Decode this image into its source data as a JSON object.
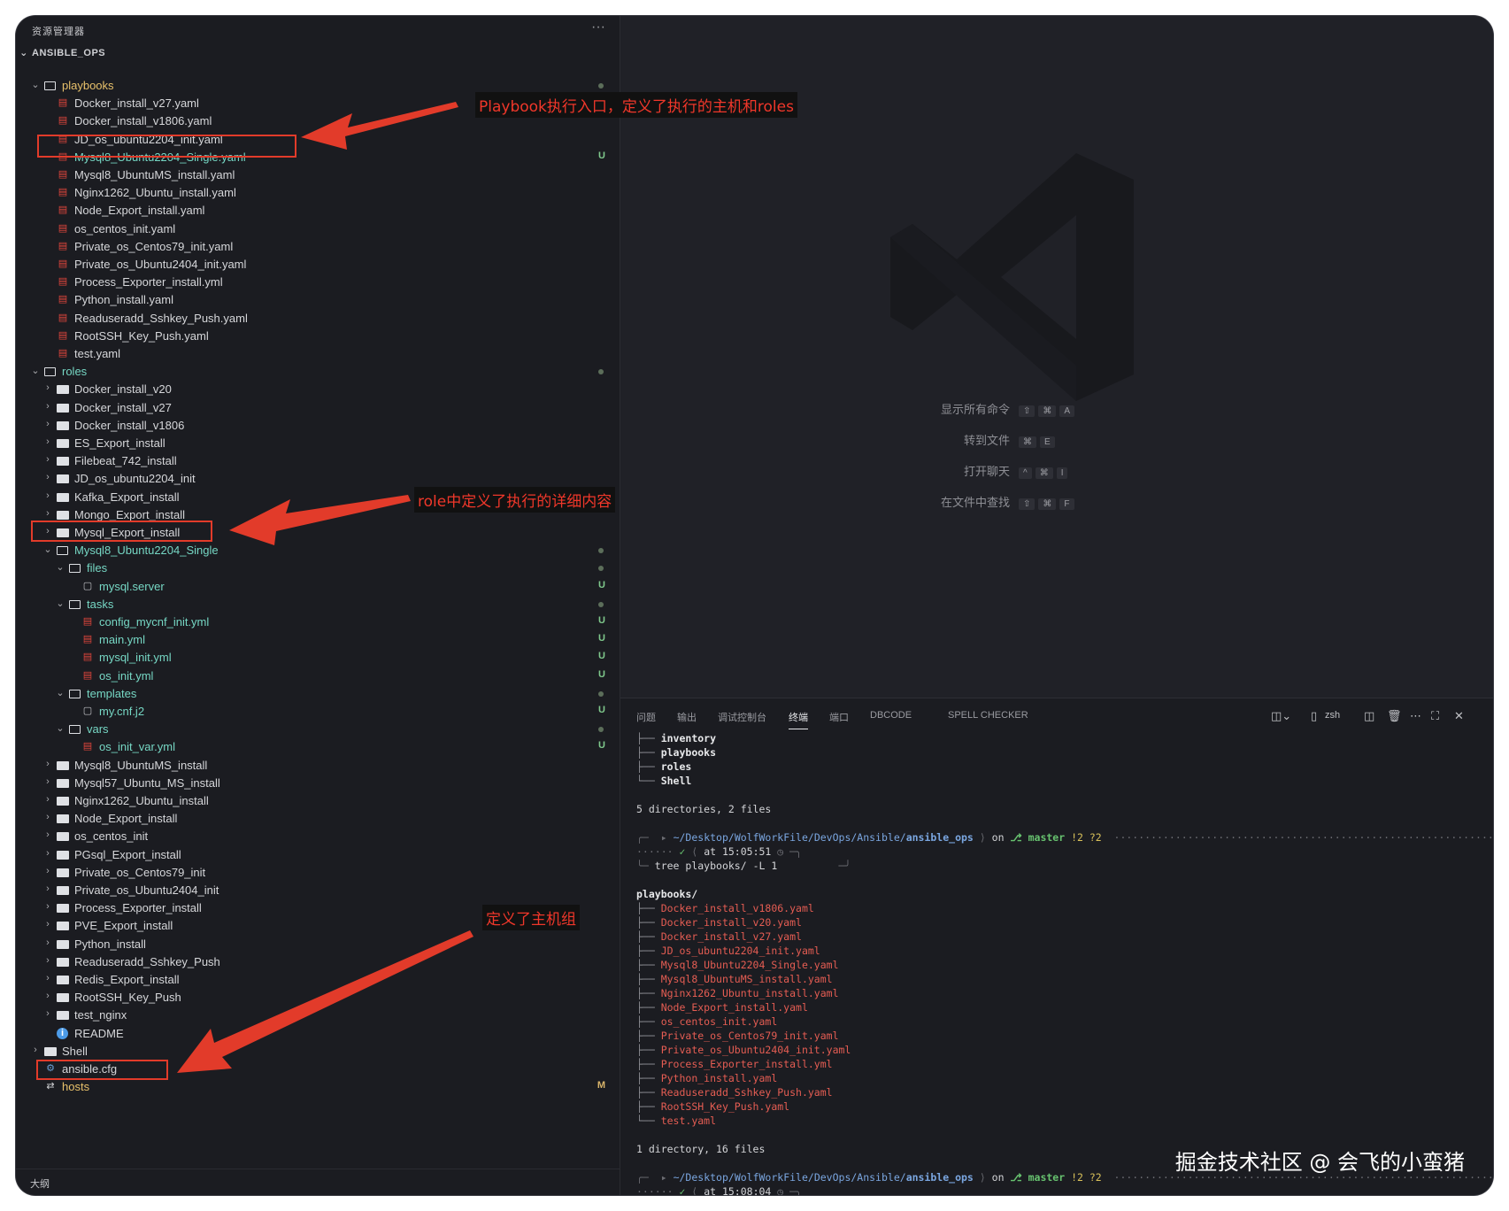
{
  "sidebar": {
    "title": "资源管理器",
    "more": "···",
    "section": "ANSIBLE_OPS",
    "outline": "大纲",
    "rows": [
      {
        "depth": 0,
        "twisty": "v",
        "icon": "folder-open",
        "label": "playbooks",
        "color": "yellow",
        "status": "dot"
      },
      {
        "depth": 1,
        "icon": "yaml",
        "label": "Docker_install_v27.yaml"
      },
      {
        "depth": 1,
        "icon": "yaml",
        "label": "Docker_install_v1806.yaml"
      },
      {
        "depth": 1,
        "icon": "yaml",
        "label": "JD_os_ubuntu2204_init.yaml"
      },
      {
        "depth": 1,
        "icon": "yaml",
        "label": "Mysql8_Ubuntu2204_Single.yaml",
        "color": "teal",
        "status": "U"
      },
      {
        "depth": 1,
        "icon": "yaml",
        "label": "Mysql8_UbuntuMS_install.yaml"
      },
      {
        "depth": 1,
        "icon": "yaml",
        "label": "Nginx1262_Ubuntu_install.yaml"
      },
      {
        "depth": 1,
        "icon": "yaml",
        "label": "Node_Export_install.yaml"
      },
      {
        "depth": 1,
        "icon": "yaml",
        "label": "os_centos_init.yaml"
      },
      {
        "depth": 1,
        "icon": "yaml",
        "label": "Private_os_Centos79_init.yaml"
      },
      {
        "depth": 1,
        "icon": "yaml",
        "label": "Private_os_Ubuntu2404_init.yaml"
      },
      {
        "depth": 1,
        "icon": "yaml",
        "label": "Process_Exporter_install.yml"
      },
      {
        "depth": 1,
        "icon": "yaml",
        "label": "Python_install.yaml"
      },
      {
        "depth": 1,
        "icon": "yaml",
        "label": "Readuseradd_Sshkey_Push.yaml"
      },
      {
        "depth": 1,
        "icon": "yaml",
        "label": "RootSSH_Key_Push.yaml"
      },
      {
        "depth": 1,
        "icon": "yaml",
        "label": "test.yaml"
      },
      {
        "depth": 0,
        "twisty": "v",
        "icon": "folder-open",
        "label": "roles",
        "color": "teal",
        "status": "dot"
      },
      {
        "depth": 1,
        "twisty": ">",
        "icon": "folder",
        "label": "Docker_install_v20"
      },
      {
        "depth": 1,
        "twisty": ">",
        "icon": "folder",
        "label": "Docker_install_v27"
      },
      {
        "depth": 1,
        "twisty": ">",
        "icon": "folder",
        "label": "Docker_install_v1806"
      },
      {
        "depth": 1,
        "twisty": ">",
        "icon": "folder",
        "label": "ES_Export_install"
      },
      {
        "depth": 1,
        "twisty": ">",
        "icon": "folder",
        "label": "Filebeat_742_install"
      },
      {
        "depth": 1,
        "twisty": ">",
        "icon": "folder",
        "label": "JD_os_ubuntu2204_init"
      },
      {
        "depth": 1,
        "twisty": ">",
        "icon": "folder",
        "label": "Kafka_Export_install"
      },
      {
        "depth": 1,
        "twisty": ">",
        "icon": "folder",
        "label": "Mongo_Export_install"
      },
      {
        "depth": 1,
        "twisty": ">",
        "icon": "folder",
        "label": "Mysql_Export_install"
      },
      {
        "depth": 1,
        "twisty": "v",
        "icon": "folder-open",
        "label": "Mysql8_Ubuntu2204_Single",
        "color": "teal",
        "status": "dot"
      },
      {
        "depth": 2,
        "twisty": "v",
        "icon": "folder-open",
        "label": "files",
        "color": "teal",
        "status": "dot"
      },
      {
        "depth": 3,
        "icon": "file",
        "label": "mysql.server",
        "color": "teal",
        "status": "U"
      },
      {
        "depth": 2,
        "twisty": "v",
        "icon": "folder-open",
        "label": "tasks",
        "color": "teal",
        "status": "dot"
      },
      {
        "depth": 3,
        "icon": "yaml",
        "label": "config_mycnf_init.yml",
        "color": "teal",
        "status": "U"
      },
      {
        "depth": 3,
        "icon": "yaml",
        "label": "main.yml",
        "color": "teal",
        "status": "U"
      },
      {
        "depth": 3,
        "icon": "yaml",
        "label": "mysql_init.yml",
        "color": "teal",
        "status": "U"
      },
      {
        "depth": 3,
        "icon": "yaml",
        "label": "os_init.yml",
        "color": "teal",
        "status": "U"
      },
      {
        "depth": 2,
        "twisty": "v",
        "icon": "folder-open",
        "label": "templates",
        "color": "teal",
        "status": "dot"
      },
      {
        "depth": 3,
        "icon": "file",
        "label": "my.cnf.j2",
        "color": "teal",
        "status": "U"
      },
      {
        "depth": 2,
        "twisty": "v",
        "icon": "folder-open",
        "label": "vars",
        "color": "teal",
        "status": "dot"
      },
      {
        "depth": 3,
        "icon": "yaml",
        "label": "os_init_var.yml",
        "color": "teal",
        "status": "U"
      },
      {
        "depth": 1,
        "twisty": ">",
        "icon": "folder",
        "label": "Mysql8_UbuntuMS_install"
      },
      {
        "depth": 1,
        "twisty": ">",
        "icon": "folder",
        "label": "Mysql57_Ubuntu_MS_install"
      },
      {
        "depth": 1,
        "twisty": ">",
        "icon": "folder",
        "label": "Nginx1262_Ubuntu_install"
      },
      {
        "depth": 1,
        "twisty": ">",
        "icon": "folder",
        "label": "Node_Export_install"
      },
      {
        "depth": 1,
        "twisty": ">",
        "icon": "folder",
        "label": "os_centos_init"
      },
      {
        "depth": 1,
        "twisty": ">",
        "icon": "folder",
        "label": "PGsql_Export_install"
      },
      {
        "depth": 1,
        "twisty": ">",
        "icon": "folder",
        "label": "Private_os_Centos79_init"
      },
      {
        "depth": 1,
        "twisty": ">",
        "icon": "folder",
        "label": "Private_os_Ubuntu2404_init"
      },
      {
        "depth": 1,
        "twisty": ">",
        "icon": "folder",
        "label": "Process_Exporter_install"
      },
      {
        "depth": 1,
        "twisty": ">",
        "icon": "folder",
        "label": "PVE_Export_install"
      },
      {
        "depth": 1,
        "twisty": ">",
        "icon": "folder",
        "label": "Python_install"
      },
      {
        "depth": 1,
        "twisty": ">",
        "icon": "folder",
        "label": "Readuseradd_Sshkey_Push"
      },
      {
        "depth": 1,
        "twisty": ">",
        "icon": "folder",
        "label": "Redis_Export_install"
      },
      {
        "depth": 1,
        "twisty": ">",
        "icon": "folder",
        "label": "RootSSH_Key_Push"
      },
      {
        "depth": 1,
        "twisty": ">",
        "icon": "folder",
        "label": "test_nginx"
      },
      {
        "depth": 1,
        "icon": "info",
        "label": "README"
      },
      {
        "depth": 0,
        "twisty": ">",
        "icon": "folder",
        "label": "Shell"
      },
      {
        "depth": 0,
        "icon": "gear",
        "label": "ansible.cfg"
      },
      {
        "depth": 0,
        "icon": "swap",
        "label": "hosts",
        "color": "yellow",
        "status": "M"
      }
    ]
  },
  "editor": {
    "shortcuts": [
      {
        "label": "显示所有命令",
        "keys": [
          "⇧",
          "⌘",
          "A"
        ]
      },
      {
        "label": "转到文件",
        "keys": [
          "⌘",
          "E"
        ]
      },
      {
        "label": "打开聊天",
        "keys": [
          "^",
          "⌘",
          "I"
        ]
      },
      {
        "label": "在文件中查找",
        "keys": [
          "⇧",
          "⌘",
          "F"
        ]
      }
    ]
  },
  "panel": {
    "tabs": [
      "问题",
      "输出",
      "调试控制台",
      "终端",
      "端口",
      "DBCODE",
      "SPELL CHECKER"
    ],
    "active_tab": "终端",
    "shell": "zsh"
  },
  "terminal": {
    "top_tree": [
      "inventory",
      "playbooks",
      "roles",
      "Shell"
    ],
    "summary1": "5 directories, 2 files",
    "prompt_path_prefix": "~/Desktop/WolfWorkFile/DevOps/Ansible/",
    "prompt_path_bold": "ansible_ops",
    "on": "on",
    "branch": "master",
    "git_status": "!2 ?2",
    "check": "✓",
    "time1": "at 15:05:51",
    "command": "tree",
    "command_arg": "playbooks/",
    "command_flags": "-L 1",
    "listing_header": "playbooks/",
    "playbooks_files": [
      "Docker_install_v1806.yaml",
      "Docker_install_v20.yaml",
      "Docker_install_v27.yaml",
      "JD_os_ubuntu2204_init.yaml",
      "Mysql8_Ubuntu2204_Single.yaml",
      "Mysql8_UbuntuMS_install.yaml",
      "Nginx1262_Ubuntu_install.yaml",
      "Node_Export_install.yaml",
      "os_centos_init.yaml",
      "Private_os_Centos79_init.yaml",
      "Private_os_Ubuntu2404_init.yaml",
      "Process_Exporter_install.yml",
      "Python_install.yaml",
      "Readuseradd_Sshkey_Push.yaml",
      "RootSSH_Key_Push.yaml",
      "test.yaml"
    ],
    "summary2": "1 directory, 16 files",
    "time2": "at 15:08:04"
  },
  "annotations": {
    "playbook": "Playbook执行入口，定义了执行的主机和roles",
    "role": "role中定义了执行的详细内容",
    "hosts": "定义了主机组"
  },
  "watermark": "掘金技术社区 @ 会飞的小蛮猪",
  "colors": {
    "accent_red": "#e23b2a",
    "untracked": "#7fc98c",
    "modified": "#d9b56a",
    "folder_yellow": "#e8c16b",
    "teal": "#76d7c4"
  }
}
